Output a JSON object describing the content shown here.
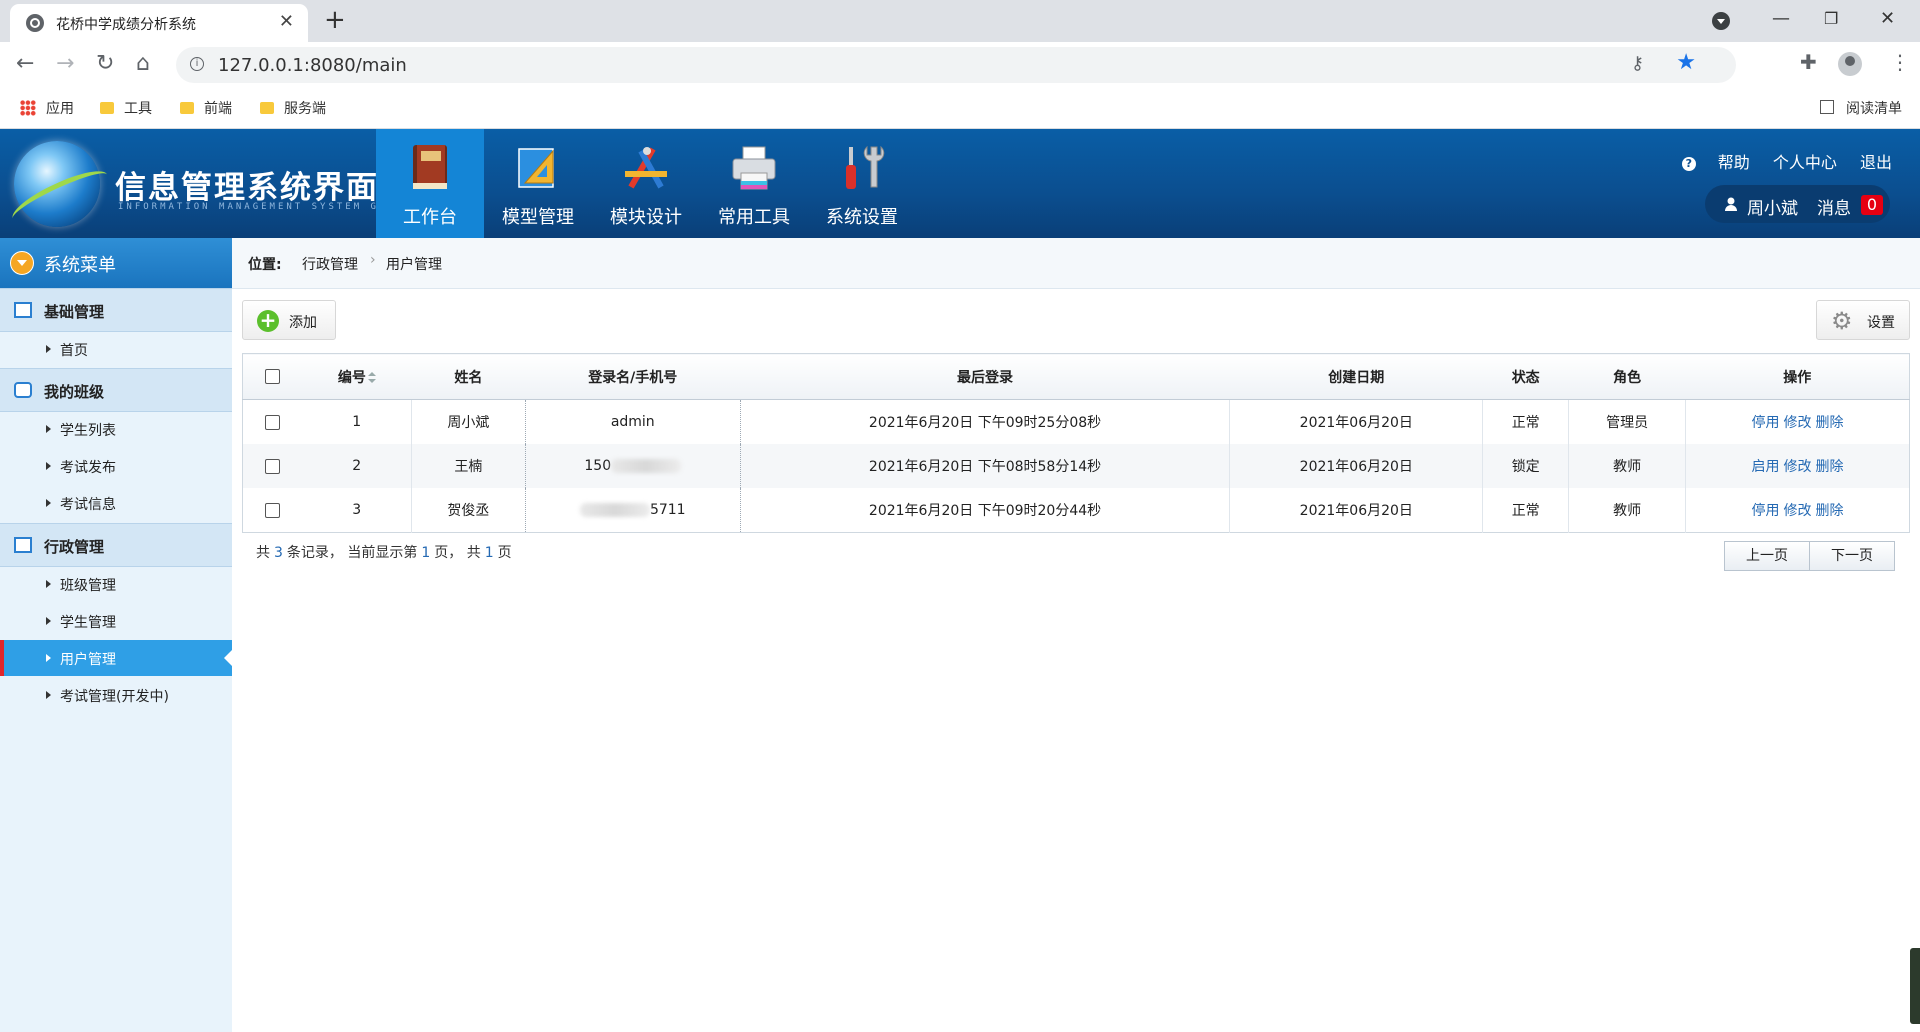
{
  "browser": {
    "tab_title": "花桥中学成绩分析系统",
    "url": "127.0.0.1:8080/main",
    "bookmarks": [
      "应用",
      "工具",
      "前端",
      "服务端"
    ],
    "reading_list": "阅读清单"
  },
  "header": {
    "logo_title": "信息管理系统界面",
    "logo_subtitle": "INFORMATION MANAGEMENT SYSTEM GUI",
    "nav": [
      {
        "label": "工作台",
        "icon": "book-icon"
      },
      {
        "label": "模型管理",
        "icon": "ruler-triangle-icon"
      },
      {
        "label": "模块设计",
        "icon": "drafting-tools-icon"
      },
      {
        "label": "常用工具",
        "icon": "printer-icon"
      },
      {
        "label": "系统设置",
        "icon": "wrench-screwdriver-icon"
      }
    ],
    "help": "帮助",
    "profile": "个人中心",
    "logout": "退出",
    "user": "周小斌",
    "messages_label": "消息",
    "messages_count": "0"
  },
  "sidebar": {
    "title": "系统菜单",
    "sections": [
      {
        "title": "基础管理",
        "items": [
          "首页"
        ]
      },
      {
        "title": "我的班级",
        "items": [
          "学生列表",
          "考试发布",
          "考试信息"
        ]
      },
      {
        "title": "行政管理",
        "items": [
          "班级管理",
          "学生管理",
          "用户管理",
          "考试管理(开发中)"
        ]
      }
    ],
    "active_item": "用户管理"
  },
  "breadcrumb": {
    "label": "位置:",
    "path": [
      "行政管理",
      "用户管理"
    ]
  },
  "toolbar": {
    "add_label": "添加",
    "settings_label": "设置"
  },
  "table": {
    "columns": [
      "编号",
      "姓名",
      "登录名/手机号",
      "最后登录",
      "创建日期",
      "状态",
      "角色",
      "操作"
    ],
    "rows": [
      {
        "id": "1",
        "name": "周小斌",
        "login_prefix": "admin",
        "login_suffix": "",
        "masked": false,
        "last_login": "2021年6月20日 下午09时25分08秒",
        "created": "2021年06月20日",
        "status": "正常",
        "status_locked": false,
        "role": "管理员",
        "toggle": "停用",
        "edit": "修改",
        "delete": "删除"
      },
      {
        "id": "2",
        "name": "王楠",
        "login_prefix": "150",
        "login_suffix": "",
        "masked": true,
        "last_login": "2021年6月20日 下午08时58分14秒",
        "created": "2021年06月20日",
        "status": "锁定",
        "status_locked": true,
        "role": "教师",
        "toggle": "启用",
        "edit": "修改",
        "delete": "删除"
      },
      {
        "id": "3",
        "name": "贺俊丞",
        "login_prefix": "",
        "login_suffix": "5711",
        "masked": true,
        "last_login": "2021年6月20日 下午09时20分44秒",
        "created": "2021年06月20日",
        "status": "正常",
        "status_locked": false,
        "role": "教师",
        "toggle": "停用",
        "edit": "修改",
        "delete": "删除"
      }
    ]
  },
  "pagination": {
    "t1": "共",
    "total": "3",
    "t2": "条记录， 当前显示第",
    "current": "1",
    "t3": "页， 共",
    "pages": "1",
    "t4": "页",
    "prev": "上一页",
    "next": "下一页"
  }
}
